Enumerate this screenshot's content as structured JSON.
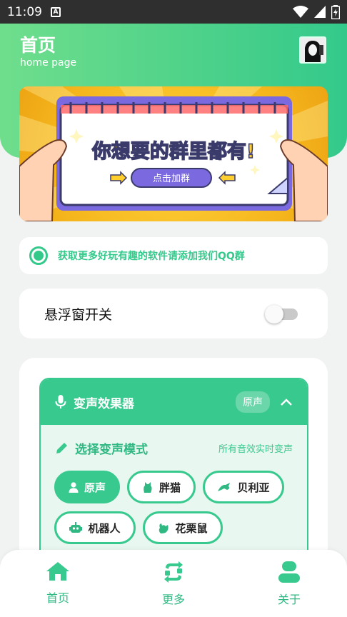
{
  "status_bar": {
    "time": "11:09",
    "notification_icon": "A"
  },
  "header": {
    "title": "首页",
    "subtitle": "home page"
  },
  "banner": {
    "headline": "你想要的群里都有!",
    "button_label": "点击加群"
  },
  "notice": {
    "text": "获取更多好玩有趣的软件请添加我们QQ群"
  },
  "floating_window": {
    "label": "悬浮窗开关",
    "enabled": false
  },
  "voice_changer": {
    "title": "变声效果器",
    "current_badge": "原声",
    "mode_title": "选择变声模式",
    "mode_hint": "所有音效实时变声",
    "modes": [
      {
        "label": "原声",
        "icon": "person-icon",
        "selected": true
      },
      {
        "label": "胖猫",
        "icon": "cat-icon",
        "selected": false
      },
      {
        "label": "贝利亚",
        "icon": "dragon-icon",
        "selected": false
      },
      {
        "label": "机器人",
        "icon": "robot-icon",
        "selected": false
      },
      {
        "label": "花栗鼠",
        "icon": "squirrel-icon",
        "selected": false
      }
    ]
  },
  "bottom_nav": [
    {
      "label": "首页",
      "icon": "home-icon"
    },
    {
      "label": "更多",
      "icon": "swap-icon"
    },
    {
      "label": "关于",
      "icon": "user-icon"
    }
  ],
  "colors": {
    "accent": "#38c98e",
    "header_start": "#6fde8c",
    "header_end": "#33c98b"
  }
}
